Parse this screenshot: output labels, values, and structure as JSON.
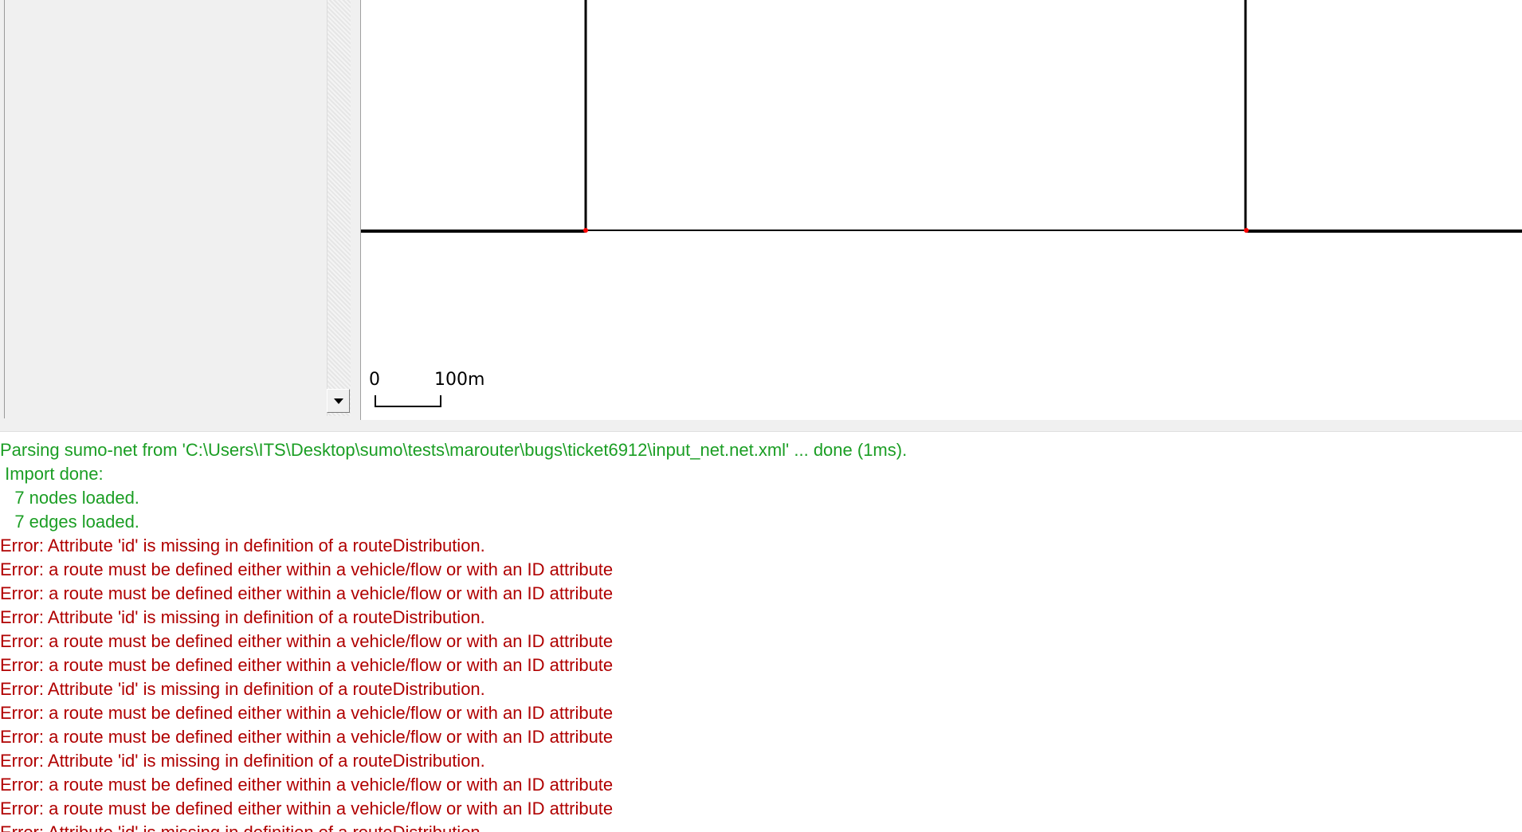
{
  "map": {
    "scale_zero": "0",
    "scale_label": "100m",
    "road_color": "#000000",
    "node_color": "#ff0000"
  },
  "message_log": {
    "lines": [
      {
        "text": "Parsing sumo-net from 'C:\\Users\\ITS\\Desktop\\sumo\\tests\\marouter\\bugs\\ticket6912\\input_net.net.xml' ... done (1ms).",
        "type": "ok"
      },
      {
        "text": " Import done:",
        "type": "ok"
      },
      {
        "text": "   7 nodes loaded.",
        "type": "ok"
      },
      {
        "text": "   7 edges loaded.",
        "type": "ok"
      },
      {
        "text": "Error: Attribute 'id' is missing in definition of a routeDistribution.",
        "type": "err"
      },
      {
        "text": "Error: a route must be defined either within a vehicle/flow or with an ID attribute",
        "type": "err"
      },
      {
        "text": "Error: a route must be defined either within a vehicle/flow or with an ID attribute",
        "type": "err"
      },
      {
        "text": "Error: Attribute 'id' is missing in definition of a routeDistribution.",
        "type": "err"
      },
      {
        "text": "Error: a route must be defined either within a vehicle/flow or with an ID attribute",
        "type": "err"
      },
      {
        "text": "Error: a route must be defined either within a vehicle/flow or with an ID attribute",
        "type": "err"
      },
      {
        "text": "Error: Attribute 'id' is missing in definition of a routeDistribution.",
        "type": "err"
      },
      {
        "text": "Error: a route must be defined either within a vehicle/flow or with an ID attribute",
        "type": "err"
      },
      {
        "text": "Error: a route must be defined either within a vehicle/flow or with an ID attribute",
        "type": "err"
      },
      {
        "text": "Error: Attribute 'id' is missing in definition of a routeDistribution.",
        "type": "err"
      },
      {
        "text": "Error: a route must be defined either within a vehicle/flow or with an ID attribute",
        "type": "err"
      },
      {
        "text": "Error: a route must be defined either within a vehicle/flow or with an ID attribute",
        "type": "err"
      },
      {
        "text": "Error: Attribute 'id' is missing in definition of a routeDistribution.",
        "type": "err"
      }
    ],
    "colors": {
      "ok": "#1b9e24",
      "err": "#b00000"
    }
  }
}
